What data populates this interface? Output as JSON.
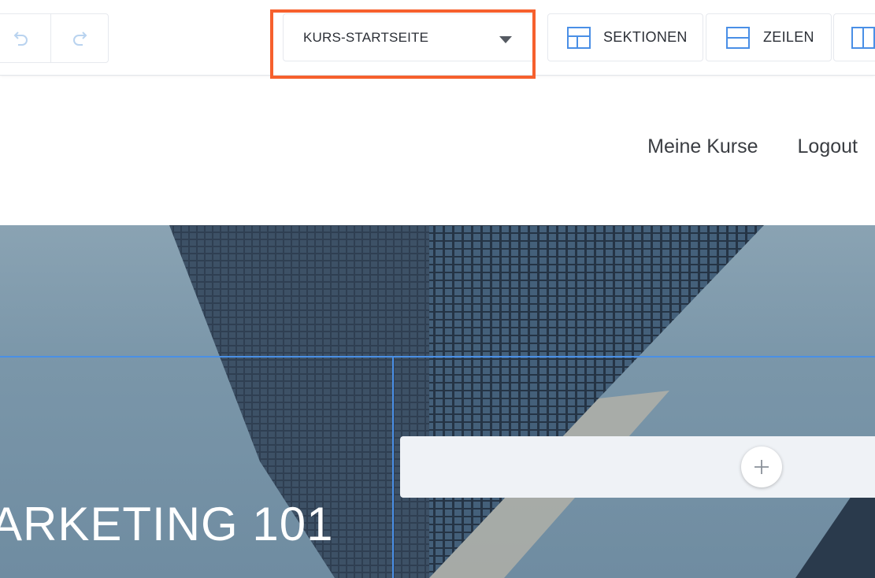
{
  "toolbar": {
    "undo_icon": "undo-icon",
    "redo_icon": "redo-icon",
    "page_selector": {
      "selected": "KURS-STARTSEITE",
      "icon": "caret-down-icon"
    },
    "sections_label": "SEKTIONEN",
    "rows_label": "ZEILEN",
    "highlight_color": "#f6602d",
    "accent_color": "#4a8fe6"
  },
  "site_nav": {
    "items": [
      "Meine Kurse",
      "Logout"
    ]
  },
  "hero": {
    "title": "ARKETING 101",
    "add_icon": "plus-icon"
  }
}
